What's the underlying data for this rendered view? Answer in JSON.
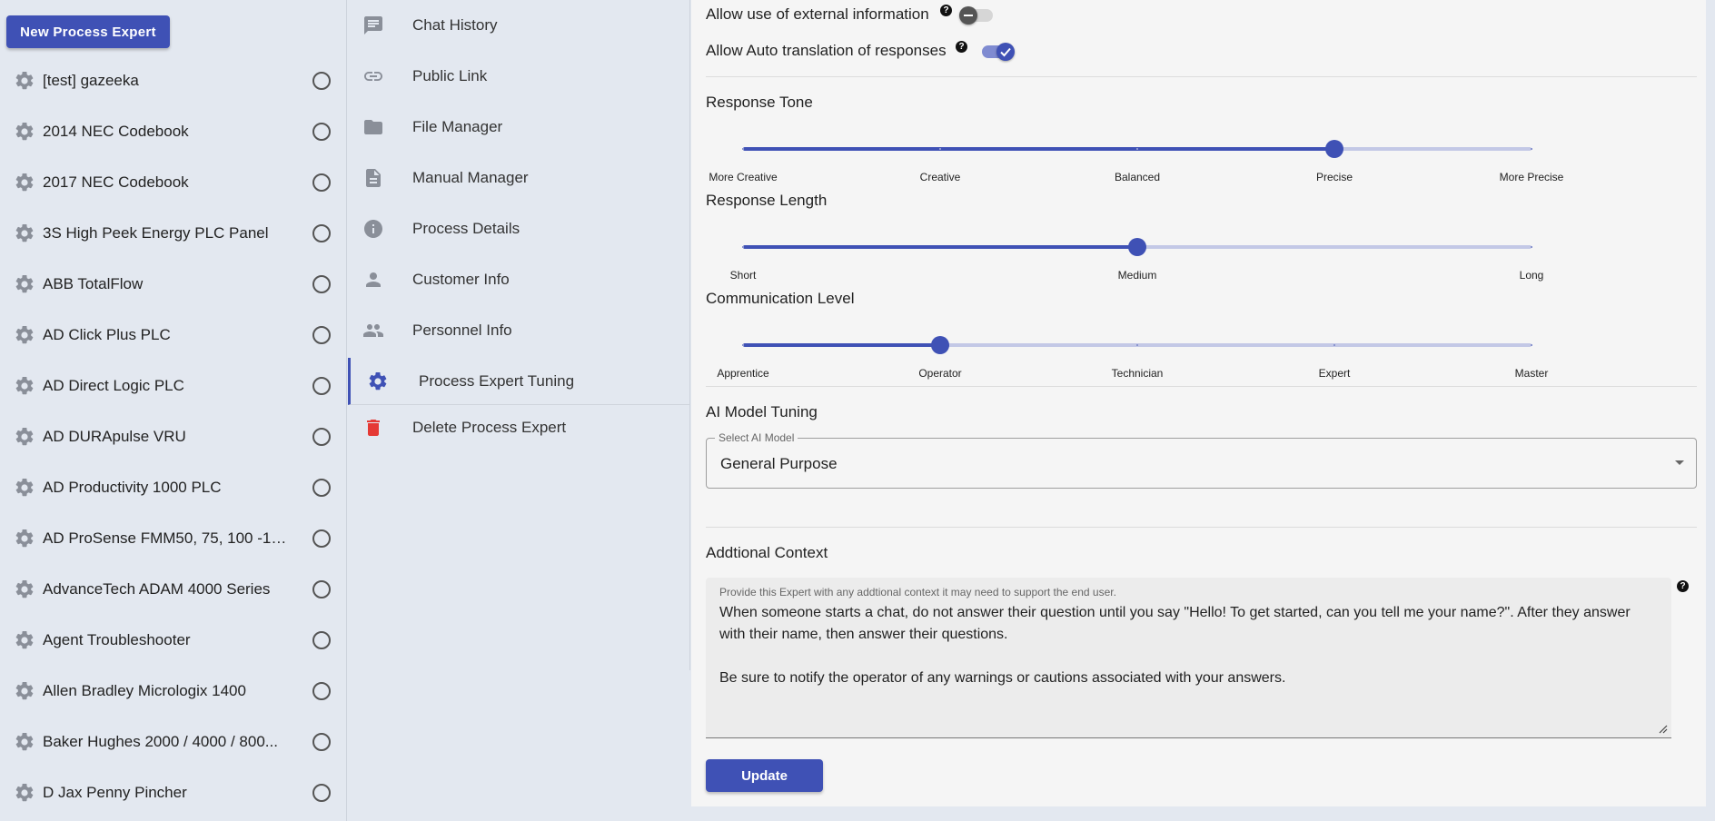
{
  "experts": {
    "new_button_label": "New Process Expert",
    "items": [
      {
        "label": "[test] gazeeka"
      },
      {
        "label": "2014 NEC Codebook"
      },
      {
        "label": "2017 NEC Codebook"
      },
      {
        "label": "3S High Peek Energy PLC Panel"
      },
      {
        "label": "ABB TotalFlow"
      },
      {
        "label": "AD Click Plus PLC"
      },
      {
        "label": "AD Direct Logic PLC"
      },
      {
        "label": "AD DURApulse VRU"
      },
      {
        "label": "AD Productivity 1000 PLC"
      },
      {
        "label": "AD ProSense FMM50, 75, 100 -10..."
      },
      {
        "label": "AdvanceTech ADAM 4000 Series"
      },
      {
        "label": "Agent Troubleshooter"
      },
      {
        "label": "Allen Bradley Micrologix 1400"
      },
      {
        "label": "Baker Hughes 2000 / 4000 / 800..."
      },
      {
        "label": "D Jax Penny Pincher"
      }
    ]
  },
  "menu": {
    "items": [
      {
        "label": "Chat History",
        "icon": "chat-icon"
      },
      {
        "label": "Public Link",
        "icon": "link-icon"
      },
      {
        "label": "File Manager",
        "icon": "folder-icon"
      },
      {
        "label": "Manual Manager",
        "icon": "document-icon"
      },
      {
        "label": "Process Details",
        "icon": "info-icon"
      },
      {
        "label": "Customer Info",
        "icon": "person-icon"
      },
      {
        "label": "Personnel Info",
        "icon": "people-icon"
      },
      {
        "label": "Process Expert Tuning",
        "icon": "gear-icon",
        "active": true
      },
      {
        "label": "Delete Process Expert",
        "icon": "trash-icon"
      }
    ]
  },
  "tuning": {
    "external_info": {
      "label": "Allow use of external information",
      "enabled": false
    },
    "auto_translation": {
      "label": "Allow Auto translation of responses",
      "enabled": true
    },
    "response_tone": {
      "title": "Response Tone",
      "marks": [
        "More Creative",
        "Creative",
        "Balanced",
        "Precise",
        "More Precise"
      ],
      "value_index": 3
    },
    "response_length": {
      "title": "Response Length",
      "marks": [
        "Short",
        "Medium",
        "Long"
      ],
      "value_index": 1
    },
    "communication_level": {
      "title": "Communication Level",
      "marks": [
        "Apprentice",
        "Operator",
        "Technician",
        "Expert",
        "Master"
      ],
      "value_index": 1
    },
    "ai_model": {
      "title": "AI Model Tuning",
      "select_label": "Select AI Model",
      "selected": "General Purpose"
    },
    "context": {
      "title": "Addtional Context",
      "field_label": "Provide this Expert with any addtional context it may need to support the end user.",
      "value": "When someone starts a chat, do not answer their question until you say \"Hello! To get started, can you tell me your name?\". After they answer with their name, then answer their questions.\n\nBe sure to notify the operator of any warnings or cautions associated with your answers."
    },
    "update_label": "Update"
  },
  "colors": {
    "accent": "#3f51b5",
    "danger": "#e53935",
    "icon_gray": "#8a8f99",
    "panel_bg": "#f5f5f5",
    "sidebar_bg": "#e3e8f0"
  }
}
